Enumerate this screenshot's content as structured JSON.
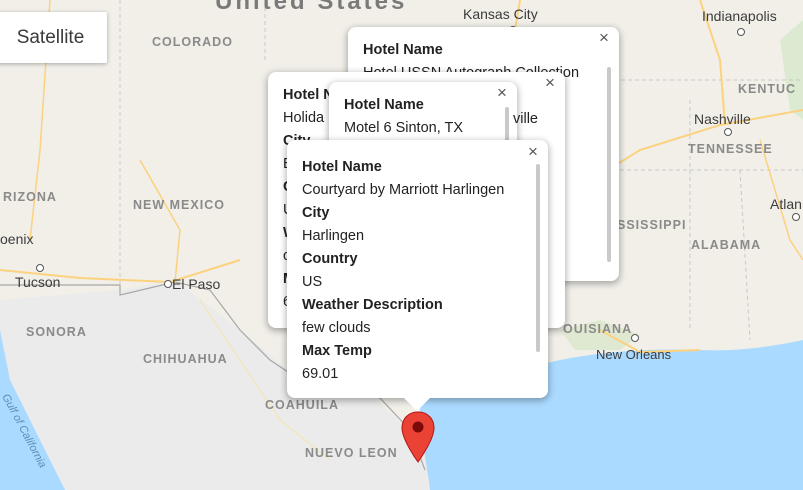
{
  "map": {
    "country_label": "United States",
    "state_labels": {
      "colorado": "COLORADO",
      "arizona": "RIZONA",
      "new_mexico": "NEW MEXICO",
      "kentucky": "KENTUC",
      "tennessee": "TENNESSEE",
      "mississippi": "SSISSIPPI",
      "alabama": "ALABAMA",
      "louisiana": "OUISIANA",
      "sonora": "SONORA",
      "chihuahua": "CHIHUAHUA",
      "coahuila": "COAHUILA",
      "nuevo_leon": "NUEVO LEON"
    },
    "city_labels": {
      "kansas_city": "Kansas City",
      "indianapolis": "Indianapolis",
      "nashville": "Nashville",
      "atlanta": "Atlan",
      "phoenix": "oenix",
      "tucson": "Tucson",
      "el_paso": "El Paso",
      "new_orleans": "New Orleans"
    },
    "water_label": "Gulf of California",
    "colors": {
      "land": "#f1efe8",
      "water": "#aadaff",
      "mexico_land": "#ececec"
    }
  },
  "map_type_button": {
    "label": "Satellite"
  },
  "marker": {
    "icon": "map-pin-icon",
    "color": "#ea4335"
  },
  "info_windows": {
    "iw1": {
      "hotel_name_key": "Hotel Name",
      "hotel_name": "Hotel USSN Autograph Collection"
    },
    "iw2": {
      "hotel_name_key": "Hotel N",
      "hotel_name": "Holida",
      "city_key": "City",
      "city_partial": "E",
      "country_initial": "C",
      "country_partial": "U",
      "weather_initial": "W",
      "weather_partial": "c",
      "maxtemp_initial": "M",
      "maxtemp_partial": "6"
    },
    "iw3": {
      "hotel_name_key": "Hotel Name",
      "hotel_name": "Motel 6 Sinton, TX",
      "partial_text": "ville"
    },
    "iw4": {
      "hotel_name_key": "Hotel Name",
      "hotel_name": "Courtyard by Marriott Harlingen",
      "city_key": "City",
      "city": "Harlingen",
      "country_key": "Country",
      "country": "US",
      "weather_key": "Weather Description",
      "weather": "few clouds",
      "max_temp_key": "Max Temp",
      "max_temp": "69.01"
    },
    "close_label": "×"
  }
}
